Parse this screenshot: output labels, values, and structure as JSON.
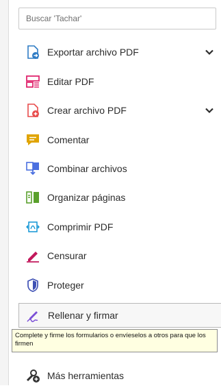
{
  "search": {
    "placeholder": "Buscar 'Tachar'"
  },
  "tools": [
    {
      "label": "Exportar archivo PDF",
      "icon": "export-pdf-icon",
      "color": "#2e7bc4",
      "has_chevron": true
    },
    {
      "label": "Editar PDF",
      "icon": "edit-pdf-icon",
      "color": "#e0266e",
      "has_chevron": false
    },
    {
      "label": "Crear archivo PDF",
      "icon": "create-pdf-icon",
      "color": "#e84b4b",
      "has_chevron": true
    },
    {
      "label": "Comentar",
      "icon": "comment-icon",
      "color": "#e0a400",
      "has_chevron": false
    },
    {
      "label": "Combinar archivos",
      "icon": "combine-files-icon",
      "color": "#4a6fe0",
      "has_chevron": false
    },
    {
      "label": "Organizar páginas",
      "icon": "organize-pages-icon",
      "color": "#5aa02c",
      "has_chevron": false
    },
    {
      "label": "Comprimir PDF",
      "icon": "compress-pdf-icon",
      "color": "#1e9bd7",
      "has_chevron": false
    },
    {
      "label": "Censurar",
      "icon": "redact-icon",
      "color": "#c2185b",
      "has_chevron": false
    },
    {
      "label": "Proteger",
      "icon": "protect-icon",
      "color": "#3f51b5",
      "has_chevron": false
    },
    {
      "label": "Rellenar y firmar",
      "icon": "fill-sign-icon",
      "color": "#7b4fd6",
      "has_chevron": false,
      "selected": true
    },
    {
      "label": "Más herramientas",
      "icon": "more-tools-icon",
      "color": "#333333",
      "has_chevron": false
    }
  ],
  "tooltip": {
    "text": "Complete y firme los formularios o envíeselos a otros para que los firmen"
  }
}
